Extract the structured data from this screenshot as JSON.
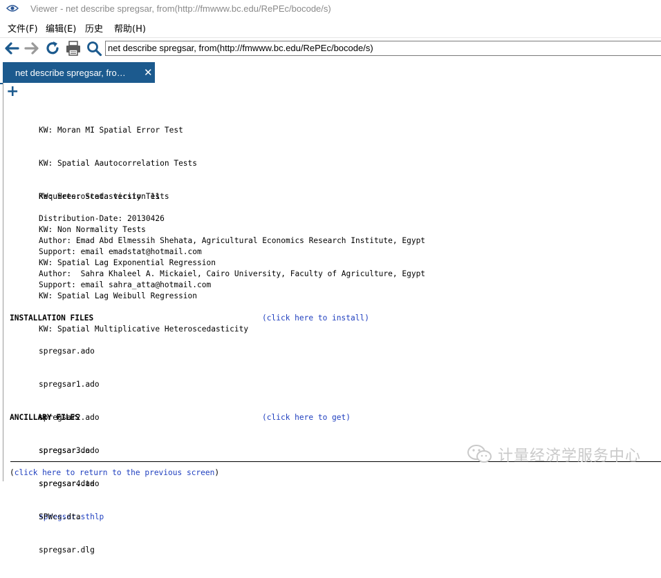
{
  "window": {
    "title": "Viewer - net describe spregsar, from(http://fmwww.bc.edu/RePEc/bocode/s)"
  },
  "menu": {
    "items": [
      "文件(F)",
      "编辑(E)",
      "历史",
      "帮助(H)"
    ]
  },
  "toolbar": {
    "address": "net describe spregsar, from(http://fmwww.bc.edu/RePEc/bocode/s)"
  },
  "tab": {
    "label": "net describe spregsar, fro…",
    "close": "✕",
    "new_tab": "+"
  },
  "content": {
    "keywords": [
      "KW: Moran MI Spatial Error Test",
      "KW: Spatial Aautocorrelation Tests",
      "KW: Heteroscedasticity Tests",
      "KW: Non Normality Tests",
      "KW: Spatial Lag Exponential Regression",
      "KW: Spatial Lag Weibull Regression",
      "KW: Spatial Multiplicative Heteroscedasticity"
    ],
    "requires": "Requires: Stata version 11",
    "distribution_date": "Distribution-Date: 20130426",
    "author1": "Author: Emad Abd Elmessih Shehata, Agricultural Economics Research Institute, Egypt",
    "support1": "Support: email emadstat@hotmail.com",
    "author2": "Author:  Sahra Khaleel A. Mickaiel, Cairo University, Faculty of Agriculture, Egypt",
    "support2": "Support: email sahra_atta@hotmail.com",
    "installation": {
      "heading": "INSTALLATION FILES",
      "paren_open": "(",
      "link": "click here to install",
      "paren_close": ")",
      "files": [
        "spregsar.ado",
        "spregsar1.ado",
        "spregsar2.ado",
        "spregsar3.ado",
        "spregsar4.ado",
        "spregsar.sthlp",
        "spregsar.dlg"
      ]
    },
    "ancillary": {
      "heading": "ANCILLARY FILES",
      "paren_open": "(",
      "link": "click here to get",
      "paren_close": ")",
      "files": [
        "spregsar.do",
        "spregsar.dta",
        "SPWcs.dta"
      ]
    },
    "return": {
      "paren_open": "(",
      "link": "click here to return to the previous screen",
      "paren_close": ")"
    }
  },
  "watermark": {
    "text": "计量经济学服务中心"
  },
  "colors": {
    "accent": "#1c5a8e",
    "link": "#1f3fbf"
  }
}
